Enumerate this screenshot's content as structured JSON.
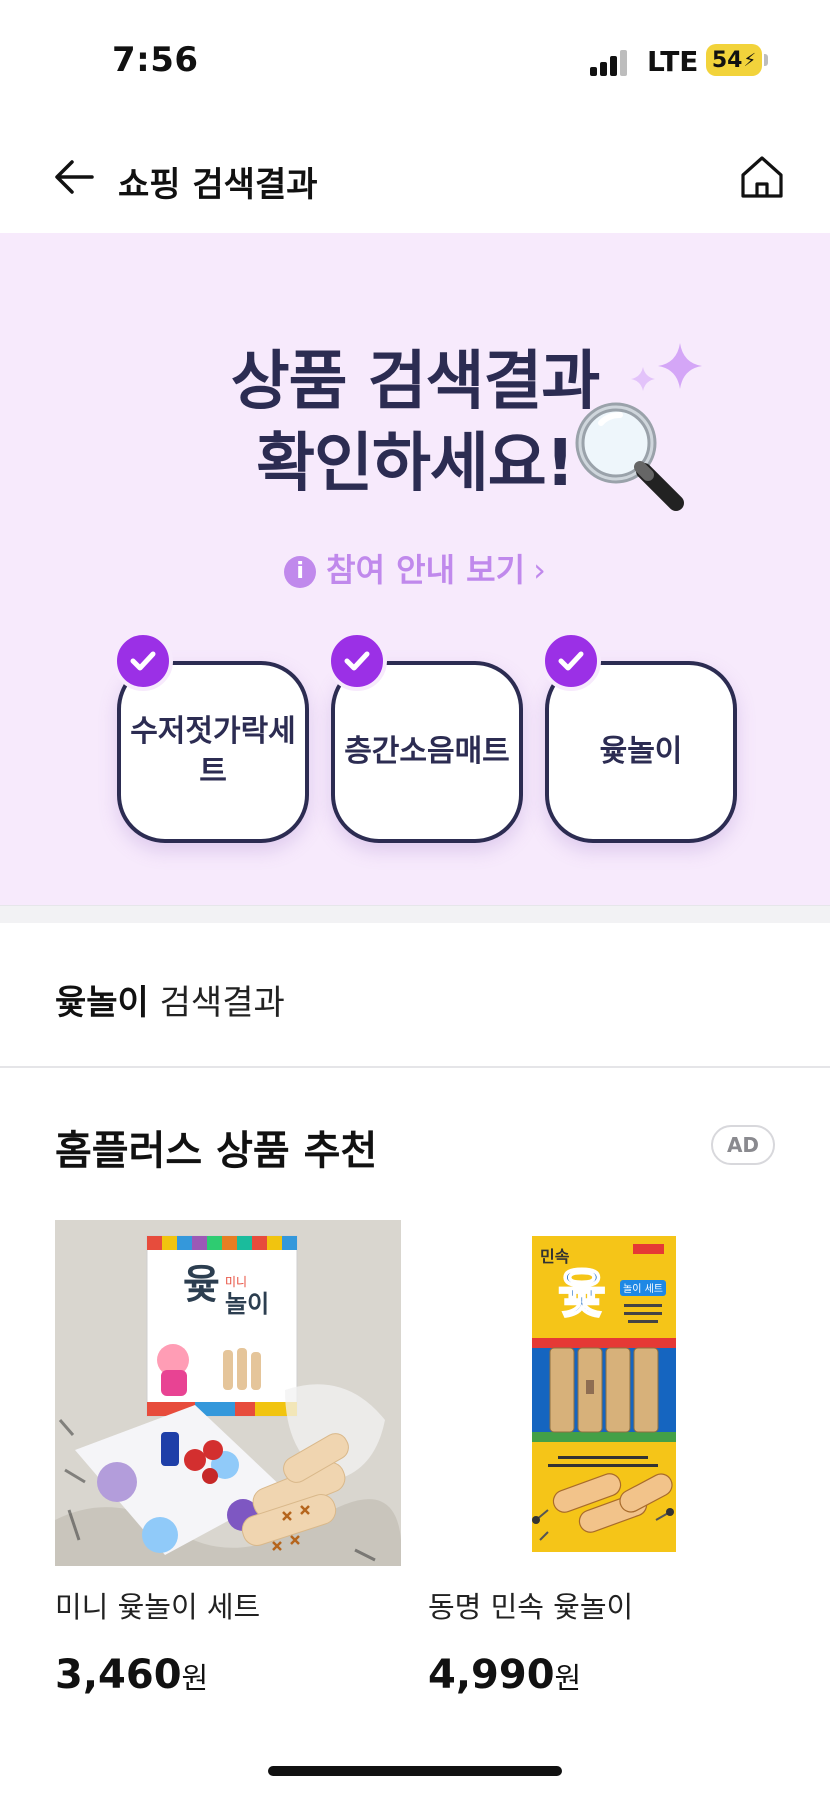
{
  "status": {
    "time": "7:56",
    "network": "LTE",
    "battery": "54"
  },
  "header": {
    "title": "쇼핑 검색결과"
  },
  "promo": {
    "title_line1": "상품 검색결과",
    "title_line2": "확인하세요!",
    "guide_link": "참여 안내 보기",
    "keywords": [
      "수저젓가락세트",
      "층간소음매트",
      "윷놀이"
    ],
    "accent_color": "#9b30e6",
    "background_color": "#f7eafc"
  },
  "search": {
    "query": "윷놀이",
    "suffix": " 검색결과"
  },
  "recommend": {
    "title": "홈플러스 상품 추천",
    "ad_label": "AD",
    "products": [
      {
        "name": "미니 윷놀이 세트",
        "price": "3,460",
        "unit": "원"
      },
      {
        "name": "동명 민속 윷놀이",
        "price": "4,990",
        "unit": "원"
      }
    ]
  },
  "images": {
    "product1_text_main": "윷",
    "product1_text_sub": "놀이",
    "product1_text_mini": "미니",
    "product2_text_top": "민속",
    "product2_text_main": "윷",
    "product2_text_badge": "놀이 세트"
  }
}
